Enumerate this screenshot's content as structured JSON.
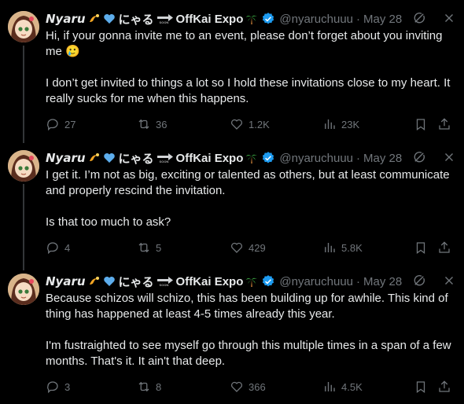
{
  "author": {
    "display_name": "Nyaru",
    "name_suffix_jp": "にゃる",
    "name_suffix_event": "OffKai Expo",
    "soon_tag": "SOON",
    "handle": "@nyaruchuuu",
    "separator": "·"
  },
  "tweets": [
    {
      "date": "May 28",
      "paragraphs": [
        "Hi, if your gonna invite me to an event, please don’t forget about you inviting me 🥲",
        "I don’t get invited to things a lot so I hold these invitations close to my heart. It really sucks for me when this happens."
      ],
      "replies": "27",
      "retweets": "36",
      "likes": "1.2K",
      "views": "23K"
    },
    {
      "date": "May 28",
      "paragraphs": [
        "I get it. I’m not as big, exciting or talented as others, but at least communicate and properly rescind the invitation.",
        "Is that too much to ask?"
      ],
      "replies": "4",
      "retweets": "5",
      "likes": "429",
      "views": "5.8K"
    },
    {
      "date": "May 28",
      "paragraphs": [
        "Because schizos will schizo, this has been building up for awhile. This kind of thing has happened at least 4-5 times already this year.",
        "I'm fustraighted to see myself go through this multiple times in a span of a few months. That's it. It ain't that deep."
      ],
      "replies": "3",
      "retweets": "8",
      "likes": "366",
      "views": "4.5K"
    }
  ],
  "icons": {
    "grok": "grok-icon",
    "more": "more-icon",
    "reply": "reply-icon",
    "retweet": "retweet-icon",
    "like": "like-icon",
    "views": "views-icon",
    "bookmark": "bookmark-icon",
    "share": "share-icon",
    "verified": "verified-badge-icon"
  },
  "colors": {
    "background": "#000000",
    "text": "#e7e9ea",
    "muted": "#71767b",
    "verified": "#1d9bf0",
    "thread_line": "#333639"
  }
}
